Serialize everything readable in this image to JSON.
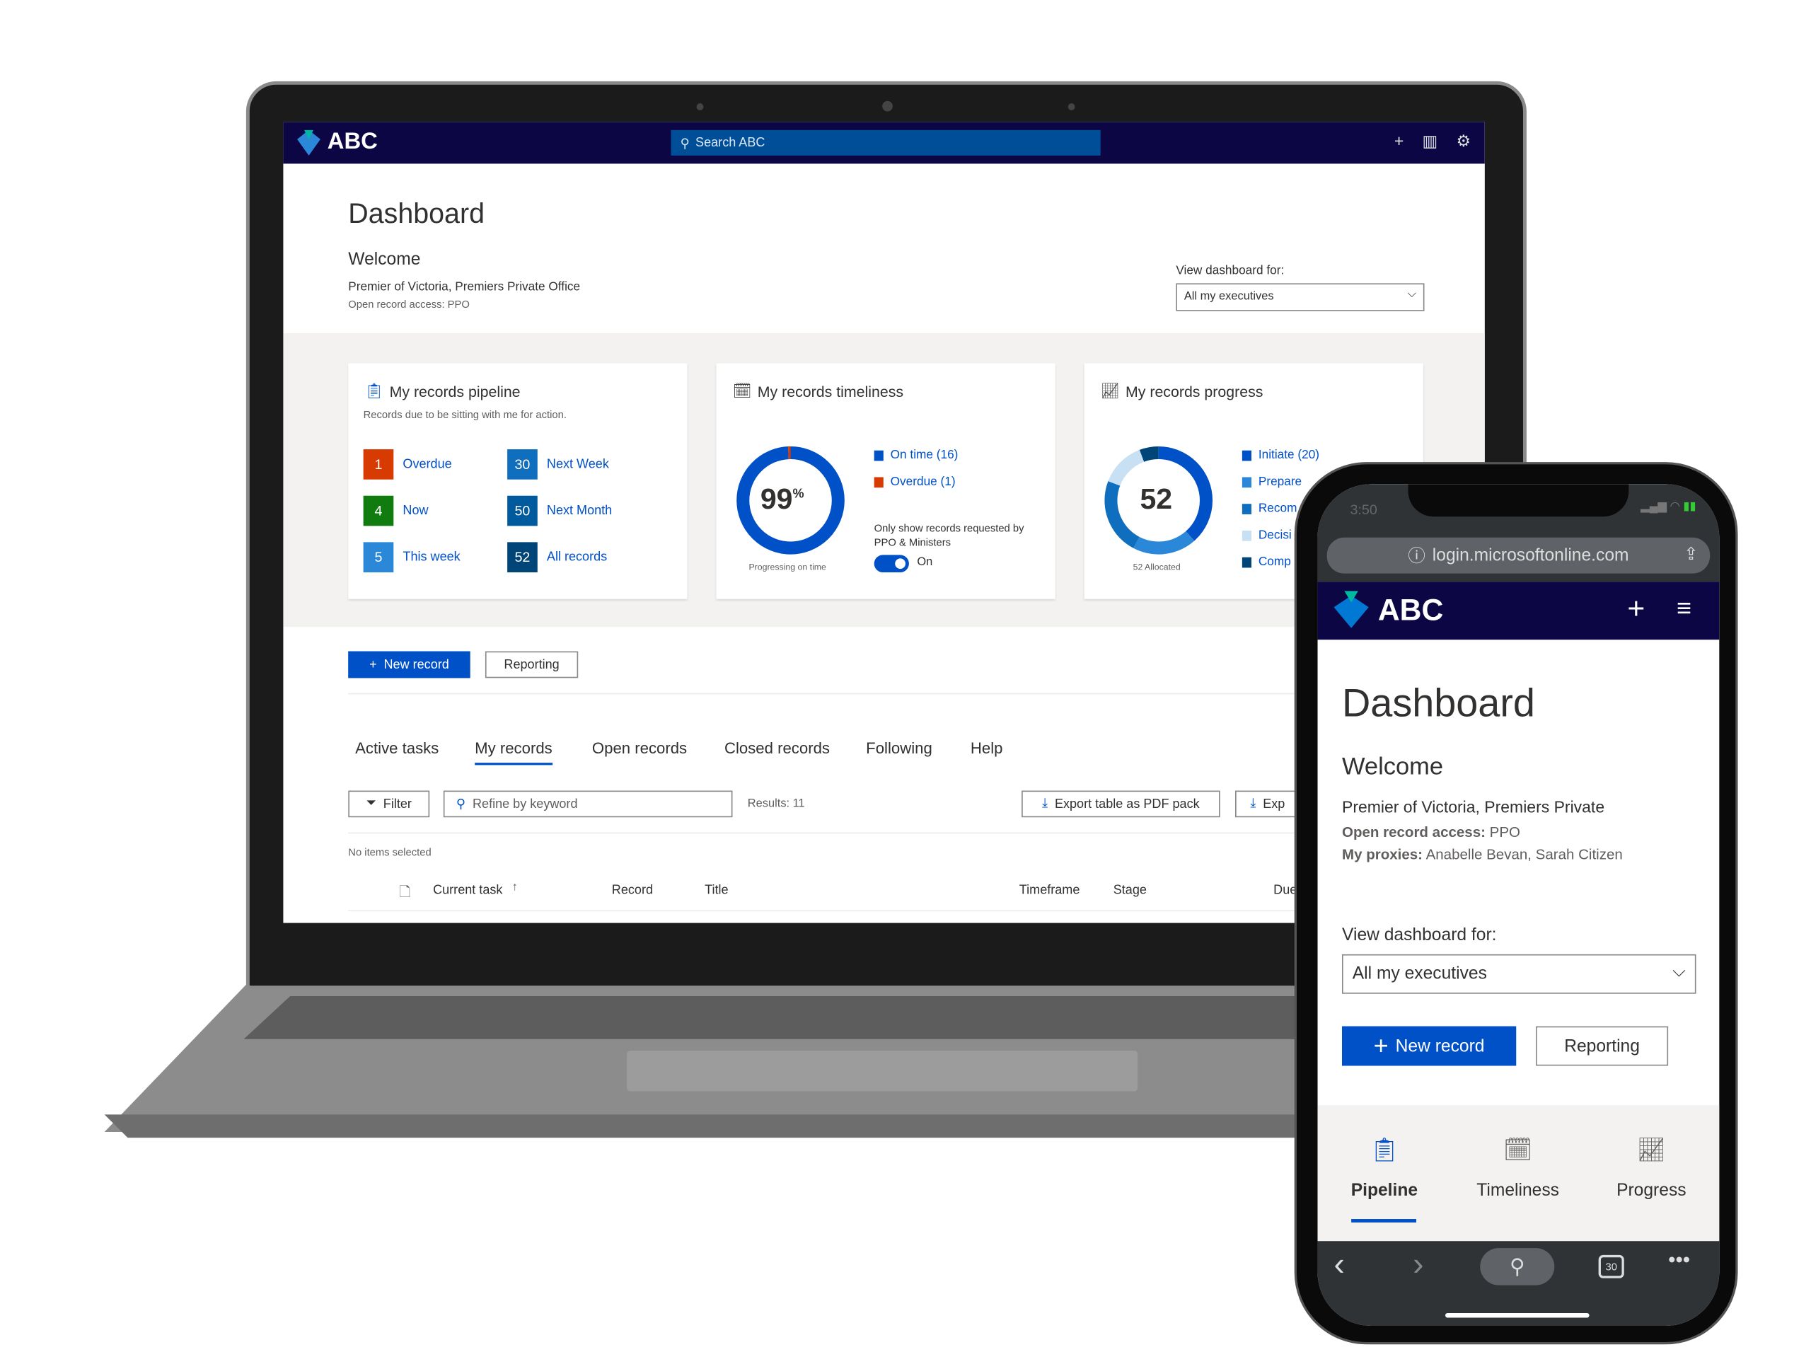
{
  "colors": {
    "header": "#0c0744",
    "accent": "#0050c8",
    "search": "#004e98",
    "overdue": "#d83b01",
    "now": "#107c10"
  },
  "app": {
    "name": "ABC",
    "search_placeholder": "Search ABC",
    "icons": [
      "plus-icon",
      "chart-icon",
      "gear-icon"
    ]
  },
  "page": {
    "title": "Dashboard",
    "welcome": "Welcome",
    "org": "Premier of Victoria, Premiers Private Office",
    "access": "Open record access: PPO",
    "view_label": "View dashboard for:",
    "view_value": "All my executives"
  },
  "pipeline": {
    "title": "My records pipeline",
    "subtitle": "Records due to be sitting with me for action.",
    "items": [
      {
        "count": "1",
        "label": "Overdue",
        "color": "#d83b01"
      },
      {
        "count": "4",
        "label": "Now",
        "color": "#107c10"
      },
      {
        "count": "5",
        "label": "This week",
        "color": "#2b88d8"
      },
      {
        "count": "30",
        "label": "Next Week",
        "color": "#106ebe"
      },
      {
        "count": "50",
        "label": "Next Month",
        "color": "#005a9e"
      },
      {
        "count": "52",
        "label": "All records",
        "color": "#004578"
      }
    ]
  },
  "timeliness": {
    "title": "My records timeliness",
    "percent": "99",
    "percent_sign": "%",
    "caption": "Progressing on time",
    "legend": [
      {
        "label": "On time  (16)",
        "value": 16,
        "color": "#0050c8"
      },
      {
        "label": "Overdue  (1)",
        "value": 1,
        "color": "#d83b01"
      }
    ],
    "toggle_label": "Only show records requested by PPO & Ministers",
    "toggle_state": "On"
  },
  "progress": {
    "title": "My records progress",
    "total": "52",
    "caption": "52 Allocated",
    "legend": [
      {
        "label": "Initiate  (20)",
        "value": 20,
        "color": "#0050c8"
      },
      {
        "label": "Prepare",
        "value": 10,
        "color": "#2b88d8"
      },
      {
        "label": "Recom",
        "value": 12,
        "color": "#106ebe"
      },
      {
        "label": "Decisi",
        "value": 7,
        "color": "#c7e0f4"
      },
      {
        "label": "Comp",
        "value": 3,
        "color": "#004578"
      }
    ]
  },
  "actions": {
    "new_record": "New record",
    "reporting": "Reporting"
  },
  "tabs": [
    {
      "label": "Active tasks"
    },
    {
      "label": "My records",
      "active": true
    },
    {
      "label": "Open records"
    },
    {
      "label": "Closed records"
    },
    {
      "label": "Following"
    },
    {
      "label": "Help"
    }
  ],
  "toolbar": {
    "filter": "Filter",
    "keyword_placeholder": "Refine by keyword",
    "results": "Results: 11",
    "export_pdf": "Export table as PDF pack",
    "export2": "Exp",
    "selection": "No items selected"
  },
  "table": {
    "columns": [
      "Current task",
      "Record",
      "Title",
      "Timeframe",
      "Stage",
      "Due"
    ]
  },
  "phone": {
    "time": "3:50",
    "url": "login.microsoftonline.com",
    "org": "Premier of Victoria, Premiers Private",
    "access_label": "Open record access:",
    "access_value": "PPO",
    "proxies_label": "My proxies:",
    "proxies_value": "Anabelle Bevan, Sarah Citizen",
    "nav": [
      {
        "label": "Pipeline",
        "active": true
      },
      {
        "label": "Timeliness"
      },
      {
        "label": "Progress"
      }
    ],
    "tabs_count": "30"
  }
}
